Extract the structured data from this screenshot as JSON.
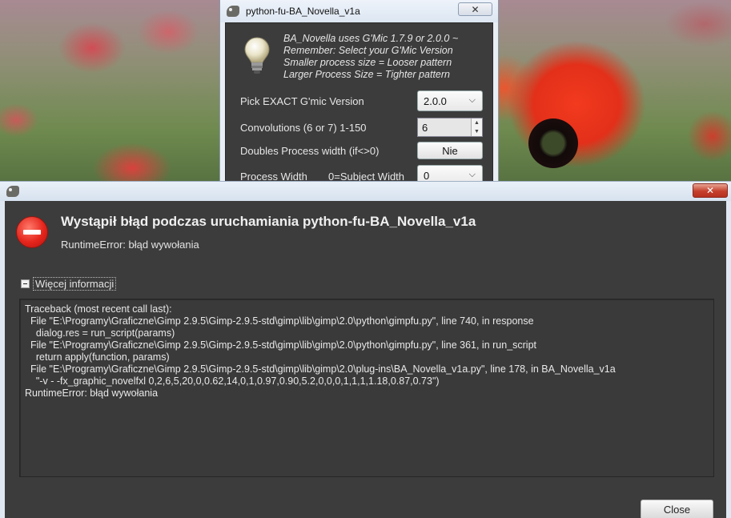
{
  "plugin_dialog": {
    "title": "python-fu-BA_Novella_v1a",
    "close_label": "✕",
    "info_lines": [
      "BA_Novella uses G'Mic 1.7.9 or 2.0.0 ~",
      "Remember: Select your G'Mic Version",
      "Smaller process size = Looser pattern",
      "Larger Process Size = Tighter pattern"
    ],
    "gmic_version_label": "Pick EXACT G'mic Version",
    "gmic_version_value": "2.0.0",
    "convolutions_label": "Convolutions (6 or 7) 1-150",
    "convolutions_value": "6",
    "doubles_label": "Doubles Process width (if<>0)",
    "doubles_value": "Nie",
    "process_width_label": "Process Width",
    "process_width_hint": "0=Subject Width",
    "process_width_value": "0"
  },
  "error_dialog": {
    "close_label": "✕",
    "title": "Wystąpił błąd podczas uruchamiania python-fu-BA_Novella_v1a",
    "subtitle": "RuntimeError: błąd wywołania",
    "expander_label": "Więcej informacji",
    "traceback": "Traceback (most recent call last):\n  File \"E:\\Programy\\Graficzne\\Gimp 2.9.5\\Gimp-2.9.5-std\\gimp\\lib\\gimp\\2.0\\python\\gimpfu.py\", line 740, in response\n    dialog.res = run_script(params)\n  File \"E:\\Programy\\Graficzne\\Gimp 2.9.5\\Gimp-2.9.5-std\\gimp\\lib\\gimp\\2.0\\python\\gimpfu.py\", line 361, in run_script\n    return apply(function, params)\n  File \"E:\\Programy\\Graficzne\\Gimp 2.9.5\\Gimp-2.9.5-std\\gimp\\lib\\gimp\\2.0\\plug-ins\\BA_Novella_v1a.py\", line 178, in BA_Novella_v1a\n    \"-v - -fx_graphic_novelfxl 0,2,6,5,20,0,0.62,14,0,1,0.97,0.90,5.2,0,0,0,1,1,1,1.18,0.87,0.73\")\nRuntimeError: błąd wywołania",
    "close_button": "Close"
  },
  "colors": {
    "dialog_bg": "#3c3c3c",
    "error_red": "#e5251c",
    "titlebar_blue": "#dfe8f2"
  }
}
